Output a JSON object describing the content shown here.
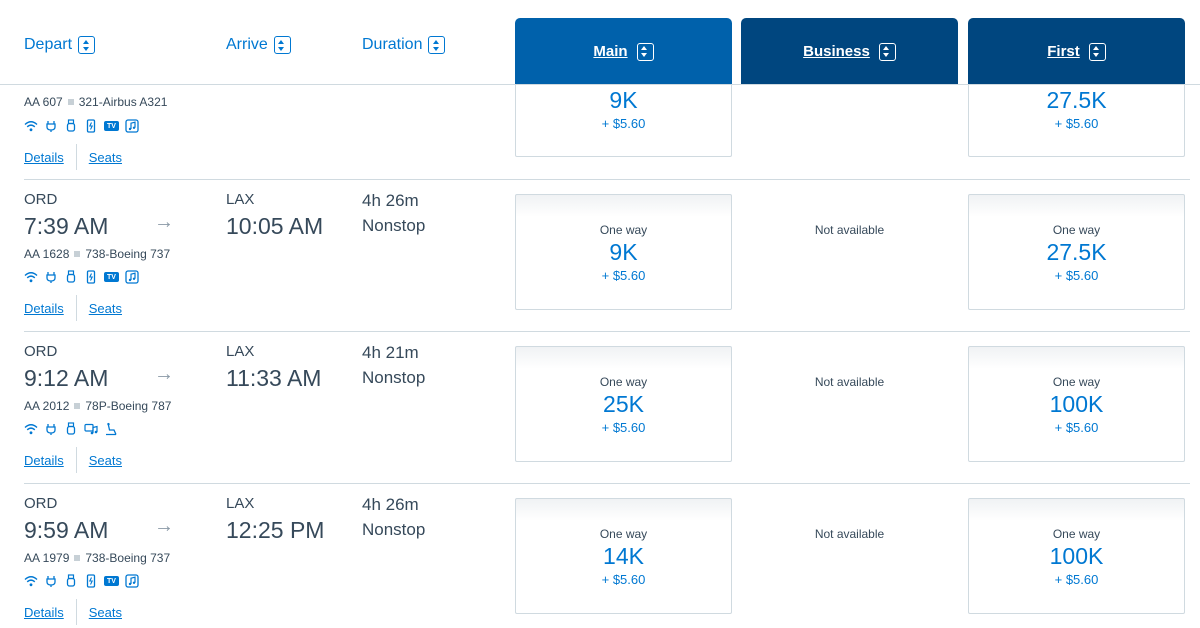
{
  "header": {
    "depart": "Depart",
    "arrive": "Arrive",
    "duration": "Duration",
    "cabins": [
      "Main",
      "Business",
      "First"
    ]
  },
  "colors": {
    "main_cabin": "#0061ab",
    "other_cabin": "#00467f",
    "link": "#0078d2"
  },
  "top_row": {
    "flight": "AA 607",
    "aircraft": "321-Airbus A321",
    "amenities": [
      "wifi-icon",
      "power-icon",
      "usb-icon",
      "phone-icon",
      "tv-icon",
      "music-icon"
    ],
    "details": "Details",
    "seats": "Seats",
    "main": {
      "points": "9K",
      "tax": "+ $5.60"
    },
    "first": {
      "points": "27.5K",
      "tax": "+ $5.60"
    }
  },
  "flights": [
    {
      "origin": "ORD",
      "depart_time": "7:39 AM",
      "dest": "LAX",
      "arrive_time": "10:05 AM",
      "duration": "4h 26m",
      "stops": "Nonstop",
      "flight": "AA 1628",
      "aircraft": "738-Boeing 737",
      "amenities": [
        "wifi-icon",
        "power-icon",
        "usb-icon",
        "phone-icon",
        "tv-icon",
        "music-icon"
      ],
      "details": "Details",
      "seats": "Seats",
      "main": {
        "label": "One way",
        "points": "9K",
        "tax": "+ $5.60"
      },
      "business": "Not available",
      "first": {
        "label": "One way",
        "points": "27.5K",
        "tax": "+ $5.60"
      }
    },
    {
      "origin": "ORD",
      "depart_time": "9:12 AM",
      "dest": "LAX",
      "arrive_time": "11:33 AM",
      "duration": "4h 21m",
      "stops": "Nonstop",
      "flight": "AA 2012",
      "aircraft": "78P-Boeing 787",
      "amenities": [
        "wifi-icon",
        "power-icon",
        "usb-icon",
        "entertainment-icon",
        "lie-flat-seat-icon"
      ],
      "details": "Details",
      "seats": "Seats",
      "main": {
        "label": "One way",
        "points": "25K",
        "tax": "+ $5.60"
      },
      "business": "Not available",
      "first": {
        "label": "One way",
        "points": "100K",
        "tax": "+ $5.60"
      }
    },
    {
      "origin": "ORD",
      "depart_time": "9:59 AM",
      "dest": "LAX",
      "arrive_time": "12:25 PM",
      "duration": "4h 26m",
      "stops": "Nonstop",
      "flight": "AA 1979",
      "aircraft": "738-Boeing 737",
      "amenities": [
        "wifi-icon",
        "power-icon",
        "usb-icon",
        "phone-icon",
        "tv-icon",
        "music-icon"
      ],
      "details": "Details",
      "seats": "Seats",
      "main": {
        "label": "One way",
        "points": "14K",
        "tax": "+ $5.60"
      },
      "business": "Not available",
      "first": {
        "label": "One way",
        "points": "100K",
        "tax": "+ $5.60"
      }
    }
  ],
  "tv_label": "TV"
}
